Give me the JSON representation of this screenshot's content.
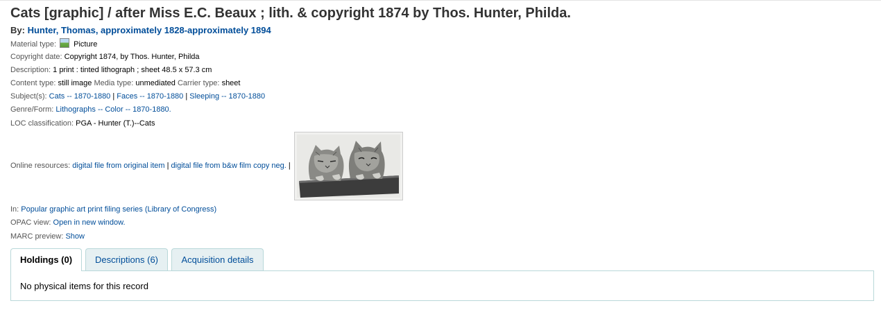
{
  "title": "Cats [graphic] / after Miss E.C. Beaux ; lith. & copyright 1874 by Thos. Hunter, Philda.",
  "byline": {
    "label": "By:",
    "author": "Hunter, Thomas, approximately 1828-approximately 1894"
  },
  "material": {
    "label": "Material type:",
    "icon": "picture-icon",
    "value": "Picture"
  },
  "copyright": {
    "label": "Copyright date:",
    "value": "Copyright 1874, by Thos. Hunter, Philda"
  },
  "description": {
    "label": "Description:",
    "value": "1 print : tinted lithograph ; sheet 48.5 x 57.3 cm"
  },
  "types": {
    "content_label": "Content type:",
    "content_value": "still image",
    "media_label": "Media type:",
    "media_value": "unmediated",
    "carrier_label": "Carrier type:",
    "carrier_value": "sheet"
  },
  "subjects": {
    "label": "Subject(s):",
    "items": [
      "Cats -- 1870-1880",
      "Faces -- 1870-1880",
      "Sleeping -- 1870-1880"
    ],
    "separator": "|"
  },
  "genre": {
    "label": "Genre/Form:",
    "value": "Lithographs -- Color -- 1870-1880."
  },
  "loc": {
    "label": "LOC classification:",
    "value": "PGA - Hunter (T.)--Cats"
  },
  "online": {
    "label": "Online resources:",
    "links": [
      "digital file from original item",
      "digital file from b&w film copy neg."
    ],
    "separator": "|"
  },
  "series": {
    "label": "In:",
    "value": "Popular graphic art print filing series (Library of Congress)"
  },
  "opac": {
    "label": "OPAC view:",
    "value": "Open in new window."
  },
  "marc": {
    "label": "MARC preview:",
    "value": "Show"
  },
  "tabs": [
    {
      "label": "Holdings (0)",
      "active": true
    },
    {
      "label": "Descriptions (6)",
      "active": false
    },
    {
      "label": "Acquisition details",
      "active": false
    }
  ],
  "panel_text": "No physical items for this record"
}
